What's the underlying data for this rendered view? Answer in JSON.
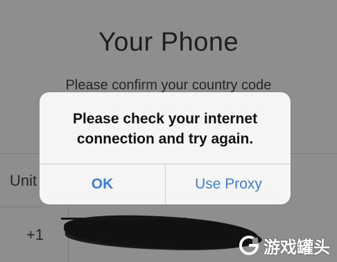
{
  "screen": {
    "title": "Your Phone",
    "subtitle": "Please confirm your country code",
    "country_label": "Unit",
    "country_code": "+1"
  },
  "alert": {
    "message_line1": "Please check your internet",
    "message_line2": "connection and try again.",
    "ok_label": "OK",
    "proxy_label": "Use Proxy"
  },
  "watermark": {
    "text": "游戏罐头",
    "logo_icon": "g-logo-icon"
  },
  "colors": {
    "accent": "#3d7fd6",
    "background_dimmed": "#8e8e8e",
    "alert_bg": "#f5f5f5"
  }
}
